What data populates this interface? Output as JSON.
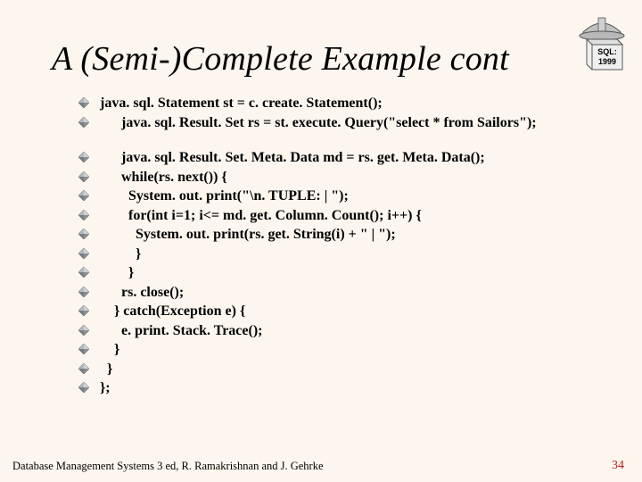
{
  "title": "A (Semi-)Complete Example cont",
  "logo": {
    "text_top": "SQL:",
    "text_bottom": "1999"
  },
  "groupA": [
    "java. sql. Statement st = c. create. Statement();",
    "      java. sql. Result. Set rs = st. execute. Query(\"select * from Sailors\");"
  ],
  "groupB": [
    "      java. sql. Result. Set. Meta. Data md = rs. get. Meta. Data();",
    "      while(rs. next()) {",
    "        System. out. print(\"\\n. TUPLE: | \");",
    "        for(int i=1; i<= md. get. Column. Count(); i++) {",
    "          System. out. print(rs. get. String(i) + \" | \");",
    "          }",
    "        }",
    "      rs. close();",
    "    } catch(Exception e) {",
    "      e. print. Stack. Trace();",
    "    }",
    "  }",
    "};"
  ],
  "footer": "Database Management Systems 3 ed,  R. Ramakrishnan and J. Gehrke",
  "page": "34"
}
